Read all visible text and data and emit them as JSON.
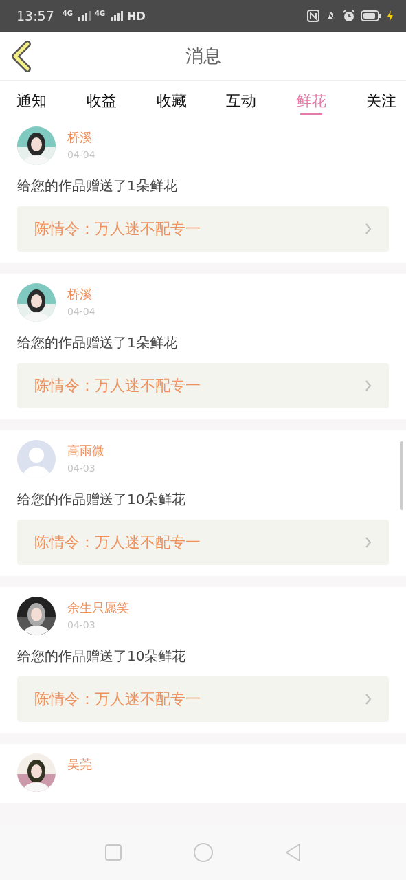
{
  "status_bar": {
    "time": "13:57",
    "network_1": "4G",
    "network_2": "4G",
    "hd": "HD"
  },
  "header": {
    "title": "消息"
  },
  "tabs": [
    {
      "label": "通知",
      "selected": false
    },
    {
      "label": "收益",
      "selected": false
    },
    {
      "label": "收藏",
      "selected": false
    },
    {
      "label": "互动",
      "selected": false
    },
    {
      "label": "鲜花",
      "selected": true
    },
    {
      "label": "关注",
      "selected": false
    }
  ],
  "messages": [
    {
      "name": "桥溪",
      "date": "04-04",
      "text": "给您的作品赠送了1朵鲜花",
      "work": "陈情令：万人迷不配专一"
    },
    {
      "name": "桥溪",
      "date": "04-04",
      "text": "给您的作品赠送了1朵鲜花",
      "work": "陈情令：万人迷不配专一"
    },
    {
      "avatar": {
        "kind": "default"
      },
      "name": "高雨微",
      "date": "04-03",
      "text": "给您的作品赠送了10朵鲜花",
      "work": "陈情令：万人迷不配专一"
    },
    {
      "name": "余生只愿笑",
      "date": "04-03",
      "text": "给您的作品赠送了10朵鲜花",
      "work": "陈情令：万人迷不配专一"
    },
    {
      "name": "吴莞"
    }
  ]
}
